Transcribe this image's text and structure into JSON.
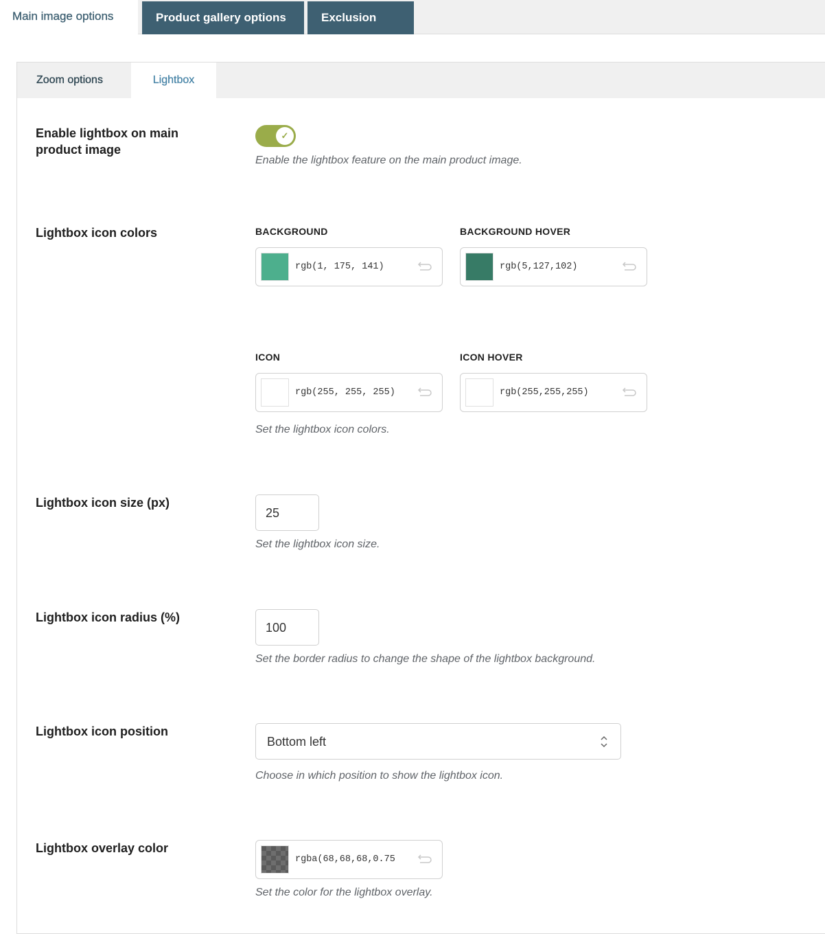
{
  "top_tabs": [
    {
      "label": "Main image options",
      "active": true
    },
    {
      "label": "Product gallery options"
    },
    {
      "label": "Exclusion List"
    }
  ],
  "sub_tabs": [
    {
      "label": "Zoom options"
    },
    {
      "label": "Lightbox",
      "active": true
    }
  ],
  "settings": {
    "enable": {
      "label": "Enable lightbox on main product image",
      "enabled": true,
      "description": "Enable the lightbox feature on the main product image."
    },
    "colors": {
      "label": "Lightbox icon colors",
      "description": "Set the lightbox icon colors.",
      "background": {
        "caption": "BACKGROUND",
        "value": "rgb(1, 175, 141)",
        "swatch": "#4daf8d"
      },
      "background_hover": {
        "caption": "BACKGROUND HOVER",
        "value": "rgb(5,127,102)",
        "swatch": "#377b66"
      },
      "icon": {
        "caption": "ICON",
        "value": "rgb(255, 255, 255)",
        "swatch": "#ffffff"
      },
      "icon_hover": {
        "caption": "ICON HOVER",
        "value": "rgb(255,255,255)",
        "swatch": "#ffffff"
      }
    },
    "size": {
      "label": "Lightbox icon size (px)",
      "value": "25",
      "description": "Set the lightbox icon size."
    },
    "radius": {
      "label": "Lightbox icon radius (%)",
      "value": "100",
      "description": "Set the border radius to change the shape of the lightbox background."
    },
    "position": {
      "label": "Lightbox icon position",
      "value": "Bottom left",
      "description": "Choose in which position to show the lightbox icon."
    },
    "overlay": {
      "label": "Lightbox overlay color",
      "value": "rgba(68,68,68,0.75",
      "description": "Set the color for the lightbox overlay."
    }
  },
  "colors": {
    "tab_dark": "#3e6072",
    "toggle_on": "#9aac4a"
  },
  "icons": {
    "reset": "undo-arrow-icon",
    "select": "chevron-up-down-icon",
    "toggle": "check-icon"
  }
}
